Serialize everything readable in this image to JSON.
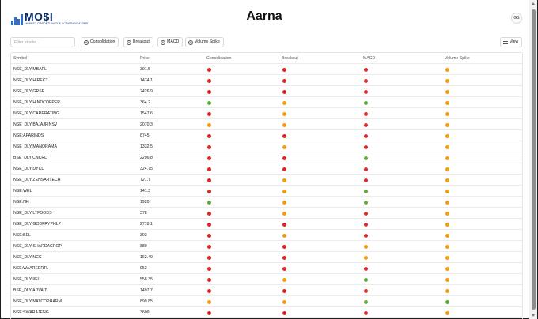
{
  "header": {
    "logo_text": "MO$I",
    "logo_subtext": "MARKET OPPORTUNITY & SCAN INDICATORS",
    "title": "Aarna",
    "avatar_initials": "GS"
  },
  "toolbar": {
    "filter_placeholder": "Filter stocks...",
    "chips": [
      "Consolidation",
      "Breakout",
      "MACD",
      "Volume Spike"
    ],
    "view_label": "View"
  },
  "table": {
    "columns": [
      "Symbol",
      "Price",
      "Consolidation",
      "Breakout",
      "MACD",
      "Volume Spike"
    ],
    "rows": [
      {
        "symbol": "NSE_DLY:MBAPL",
        "price": "391.5",
        "signals": [
          "red",
          "red",
          "red",
          "orange"
        ]
      },
      {
        "symbol": "NSE_DLY:HIRECT",
        "price": "1474.1",
        "signals": [
          "red",
          "red",
          "red",
          "orange"
        ]
      },
      {
        "symbol": "NSE_DLY:GRSE",
        "price": "2426.9",
        "signals": [
          "red",
          "red",
          "red",
          "orange"
        ]
      },
      {
        "symbol": "NSE_DLY:HINDCOPPER",
        "price": "364.2",
        "signals": [
          "green",
          "orange",
          "green",
          "orange"
        ]
      },
      {
        "symbol": "NSE_DLY:CARERATING",
        "price": "1547.6",
        "signals": [
          "red",
          "orange",
          "red",
          "orange"
        ]
      },
      {
        "symbol": "NSE_DLY:BAJAJFINSV",
        "price": "2070.3",
        "signals": [
          "orange",
          "orange",
          "red",
          "orange"
        ]
      },
      {
        "symbol": "NSE:APARINDS",
        "price": "8745",
        "signals": [
          "red",
          "red",
          "red",
          "orange"
        ]
      },
      {
        "symbol": "NSE_DLY:MANORAMA",
        "price": "1332.5",
        "signals": [
          "red",
          "orange",
          "red",
          "orange"
        ]
      },
      {
        "symbol": "BSE_DLY:CNCRD",
        "price": "2296.8",
        "signals": [
          "red",
          "red",
          "green",
          "orange"
        ]
      },
      {
        "symbol": "NSE_DLY:DYCL",
        "price": "324.75",
        "signals": [
          "red",
          "red",
          "red",
          "orange"
        ]
      },
      {
        "symbol": "NSE_DLY:ZENSARTECH",
        "price": "721.7",
        "signals": [
          "red",
          "orange",
          "red",
          "orange"
        ]
      },
      {
        "symbol": "NSE:WEL",
        "price": "141.3",
        "signals": [
          "red",
          "orange",
          "green",
          "orange"
        ]
      },
      {
        "symbol": "NSE:NH",
        "price": "1920",
        "signals": [
          "green",
          "orange",
          "green",
          "orange"
        ]
      },
      {
        "symbol": "NSE_DLY:LTFOODS",
        "price": "378",
        "signals": [
          "red",
          "orange",
          "red",
          "orange"
        ]
      },
      {
        "symbol": "NSE_DLY:GODFRYPHLP",
        "price": "2718.1",
        "signals": [
          "red",
          "red",
          "red",
          "orange"
        ]
      },
      {
        "symbol": "NSE:BEL",
        "price": "393",
        "signals": [
          "red",
          "orange",
          "red",
          "orange"
        ]
      },
      {
        "symbol": "NSE_DLY:SHARDACROP",
        "price": "880",
        "signals": [
          "red",
          "red",
          "orange",
          "orange"
        ]
      },
      {
        "symbol": "NSE_DLY:NCC",
        "price": "162.49",
        "signals": [
          "red",
          "red",
          "orange",
          "orange"
        ]
      },
      {
        "symbol": "NSE:WAAREERTL",
        "price": "953",
        "signals": [
          "red",
          "red",
          "red",
          "orange"
        ]
      },
      {
        "symbol": "NSE_DLY:IIFL",
        "price": "558.35",
        "signals": [
          "red",
          "orange",
          "green",
          "orange"
        ]
      },
      {
        "symbol": "BSE_DLY:ADVAIT",
        "price": "1497.7",
        "signals": [
          "red",
          "red",
          "red",
          "orange"
        ]
      },
      {
        "symbol": "NSE_DLY:NATCOPHARM",
        "price": "899.85",
        "signals": [
          "orange",
          "orange",
          "green",
          "green"
        ]
      },
      {
        "symbol": "NSE:SWARAJENG",
        "price": "3609",
        "signals": [
          "red",
          "red",
          "red",
          "orange"
        ]
      }
    ]
  },
  "colors": {
    "signal_red": "#dc2626",
    "signal_orange": "#f59e0b",
    "signal_green": "#5fa832",
    "brand_navy": "#0c2a6b",
    "brand_blue": "#2f6fd6"
  }
}
